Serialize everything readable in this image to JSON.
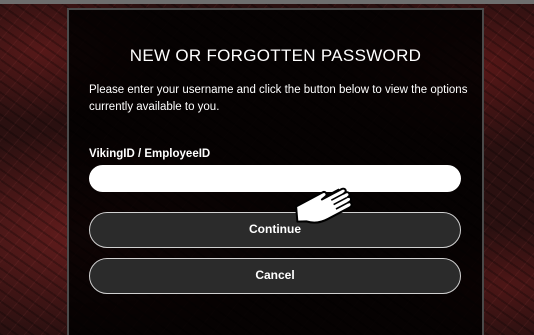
{
  "dialog": {
    "title": "NEW OR FORGOTTEN PASSWORD",
    "intro": "Please enter your username and click the button below to view the options currently available to you.",
    "field_label": "VikingID / EmployeeID",
    "field_value": "",
    "continue_label": "Continue",
    "cancel_label": "Cancel"
  },
  "cursor": {
    "icon": "hand-pointer-icon"
  }
}
